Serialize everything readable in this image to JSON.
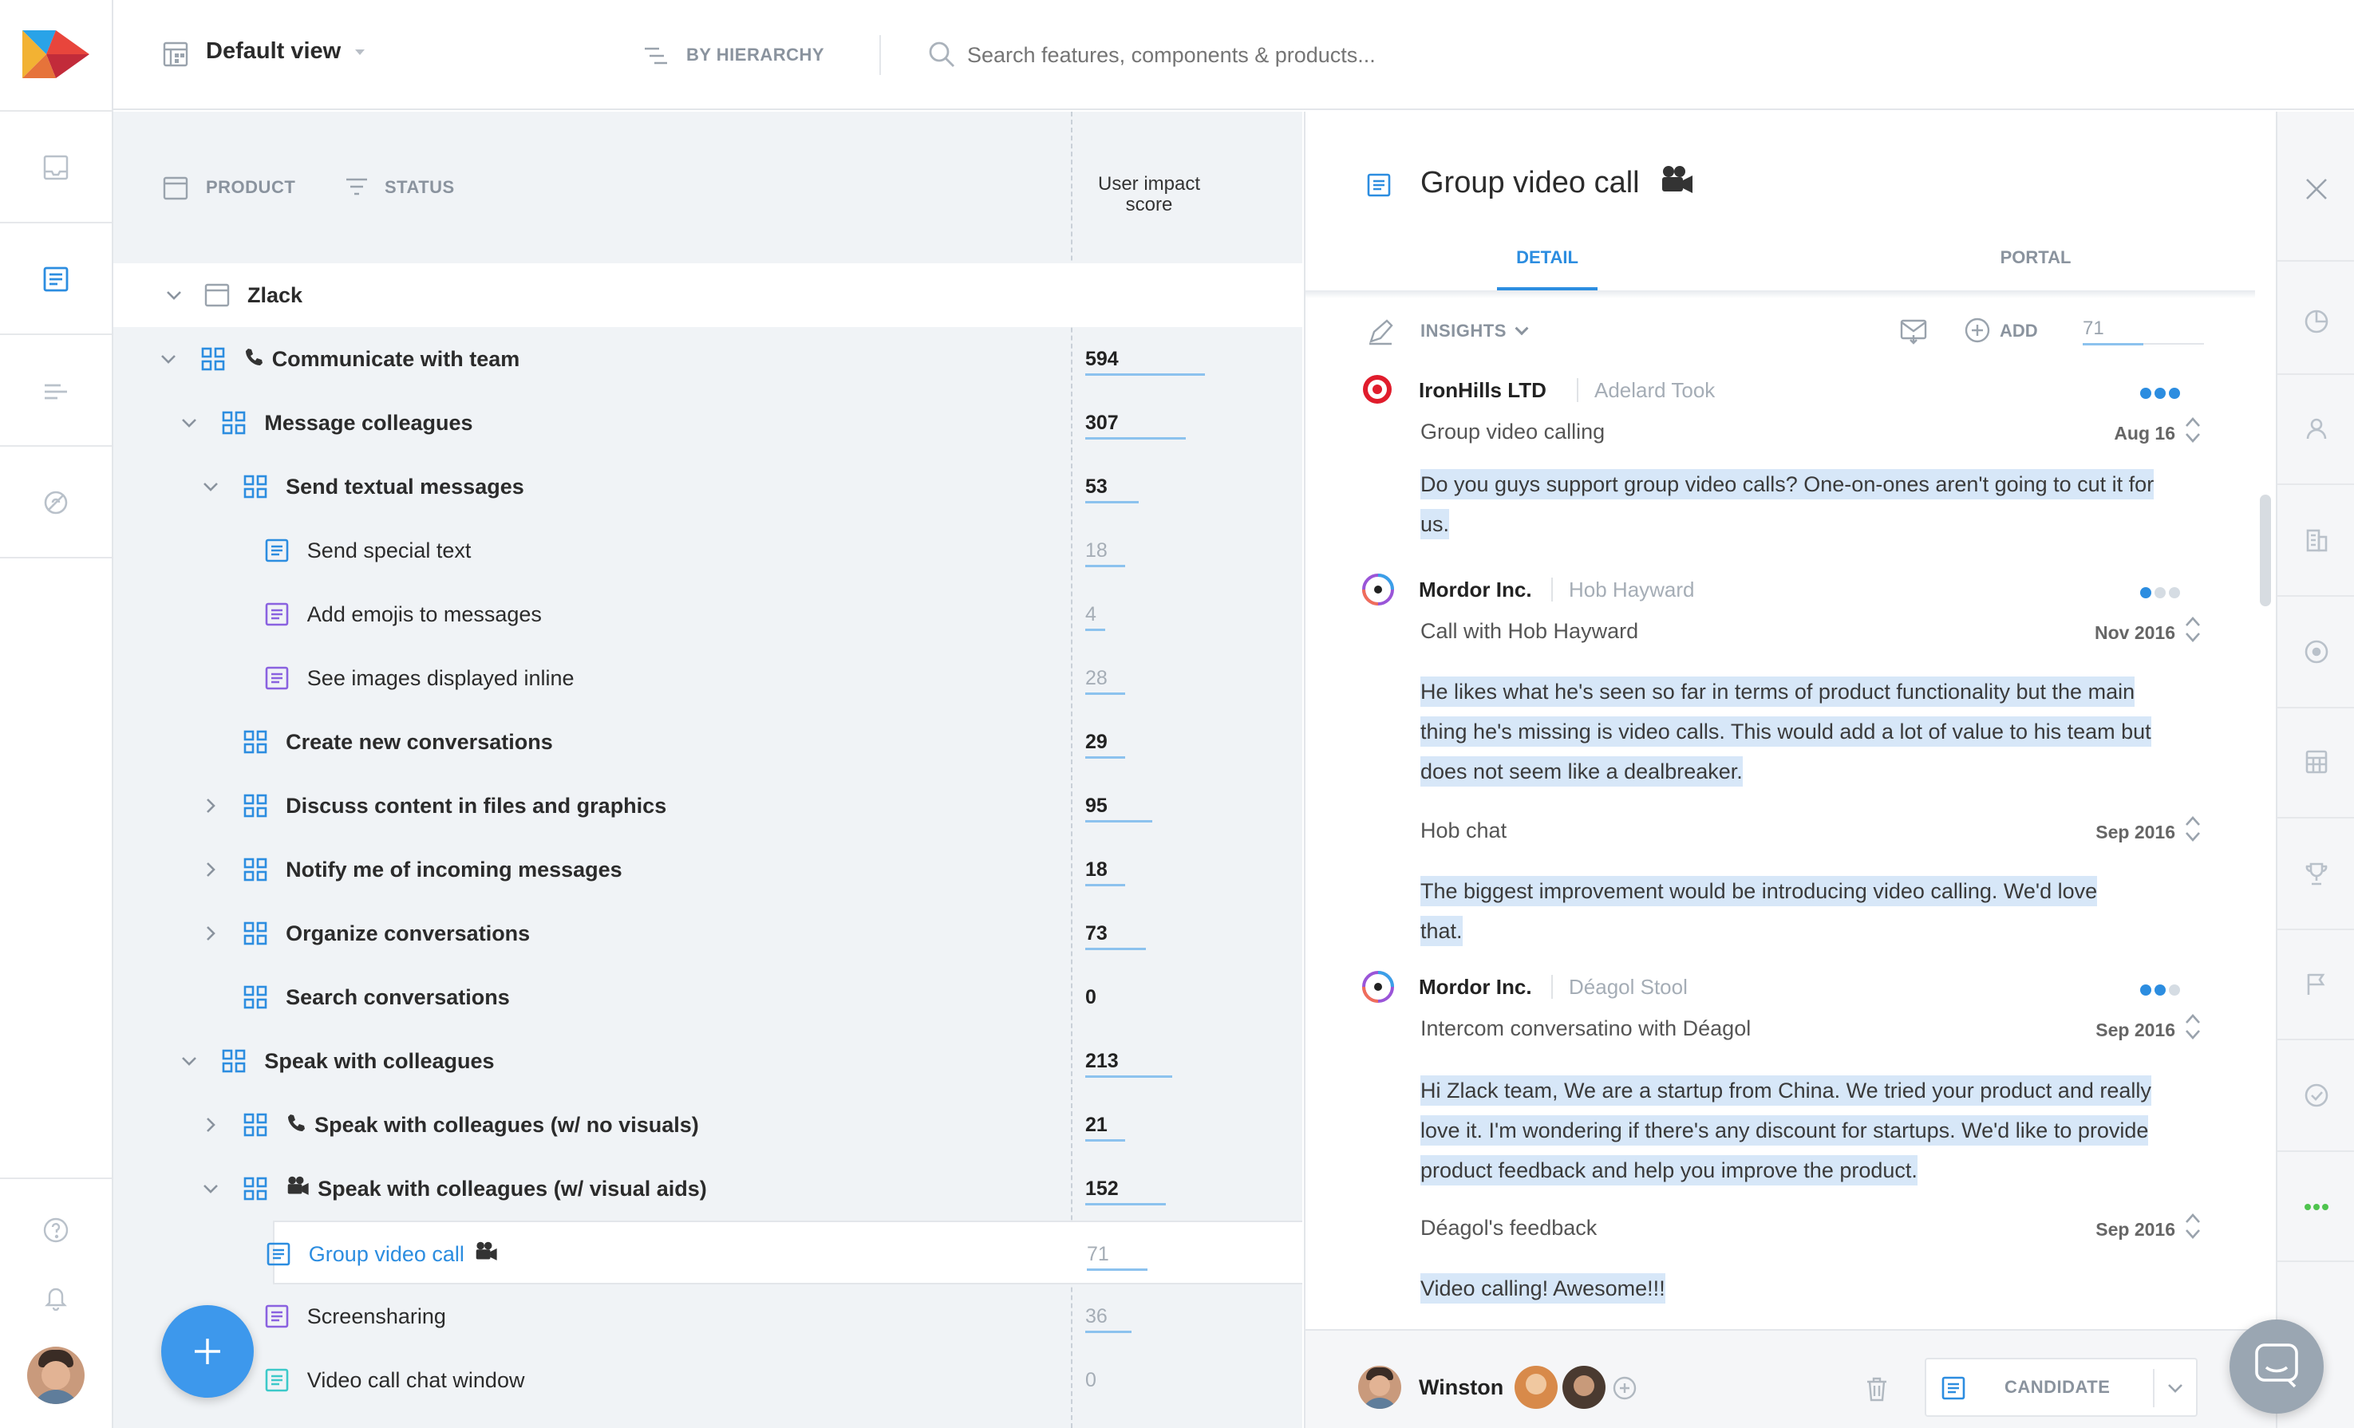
{
  "header": {
    "view_label": "Default view",
    "hierarchy_label": "BY HIERARCHY",
    "search_placeholder": "Search features, components & products..."
  },
  "tree": {
    "col_product": "PRODUCT",
    "col_status": "STATUS",
    "col_score_line1": "User impact",
    "col_score_line2": "score",
    "root": "Zlack",
    "rows": [
      {
        "label": "Communicate with team",
        "score": "594",
        "bar": 0.15
      },
      {
        "label": "Message colleagues",
        "score": "307",
        "bar": 0.126
      },
      {
        "label": "Send textual messages",
        "score": "53",
        "bar": 0.067
      },
      {
        "label": "Send special text",
        "score": "18",
        "bar": 0.05
      },
      {
        "label": "Add emojis to messages",
        "score": "4",
        "bar": 0.025
      },
      {
        "label": "See images displayed inline",
        "score": "28",
        "bar": 0.05
      },
      {
        "label": "Create new conversations",
        "score": "29",
        "bar": 0.05
      },
      {
        "label": "Discuss content in files and graphics",
        "score": "95",
        "bar": 0.084
      },
      {
        "label": "Notify me of incoming messages",
        "score": "18",
        "bar": 0.05
      },
      {
        "label": "Organize conversations",
        "score": "73",
        "bar": 0.076
      },
      {
        "label": "Search conversations",
        "score": "0",
        "bar": 0
      },
      {
        "label": "Speak with colleagues",
        "score": "213",
        "bar": 0.109
      },
      {
        "label": "Speak with colleagues (w/ no visuals)",
        "score": "21",
        "bar": 0.05
      },
      {
        "label": "Speak with colleagues (w/ visual aids)",
        "score": "152",
        "bar": 0.101
      },
      {
        "label": "Group video call",
        "score": "71",
        "bar": 0.076
      },
      {
        "label": "Screensharing",
        "score": "36",
        "bar": 0.058
      },
      {
        "label": "Video call chat window",
        "score": "0",
        "bar": 0
      }
    ]
  },
  "detail": {
    "title": "Group video call",
    "tab_detail": "DETAIL",
    "tab_portal": "PORTAL",
    "insights_label": "INSIGHTS",
    "add_label": "ADD",
    "score_value": "71",
    "insights": [
      {
        "company": "IronHills LTD",
        "person": "Adelard Took",
        "source": "Group video calling",
        "date": "Aug 16",
        "quote": "Do you guys support group video calls? One-on-ones aren't going to cut it for us."
      },
      {
        "company": "Mordor Inc.",
        "person": "Hob Hayward",
        "source": "Call with Hob Hayward",
        "date": "Nov 2016",
        "quote": "He likes what he's seen so far in terms of product functionality but the main thing he's missing is video calls. This would add a lot of value to his team but does not seem like a dealbreaker.",
        "source2": "Hob chat",
        "date2": "Sep 2016",
        "quote2": "The biggest improvement would be introducing video calling. We'd love that."
      },
      {
        "company": "Mordor Inc.",
        "person": "Déagol Stool",
        "source": "Intercom conversatino with Déagol",
        "date": "Sep 2016",
        "quote": "Hi Zlack team, We are a startup from China. We tried your product and really love it. I'm wondering if there's any discount for startups. We'd like to provide product feedback and help you improve the product.",
        "source2": "Déagol's feedback",
        "date2": "Sep 2016",
        "quote2": "Video calling! Awesome!!!"
      }
    ],
    "footer_owner": "Winston",
    "footer_status": "CANDIDATE"
  },
  "colors": {
    "accent": "#2c8de0",
    "fab": "#3d98ec",
    "purple": "#8a62e0",
    "teal": "#3cc9c9"
  }
}
